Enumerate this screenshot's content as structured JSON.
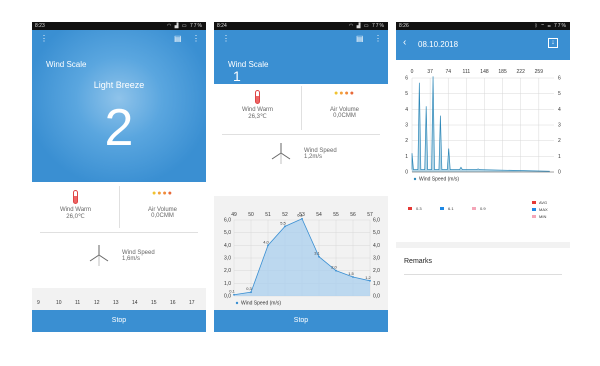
{
  "screen1": {
    "status": {
      "time": "8:23",
      "battery": "77%"
    },
    "title": "Wind Scale",
    "level_name": "Light Breeze",
    "level_number": "2",
    "wind_warm_label": "Wind Warm",
    "wind_warm_value": "26,0℃",
    "air_volume_label": "Air Volume",
    "air_volume_value": "0,0CMM",
    "wind_speed_label": "Wind Speed",
    "wind_speed_value": "1,6m/s",
    "x_ticks": [
      "9",
      "10",
      "11",
      "12",
      "13",
      "14",
      "15",
      "16",
      "17"
    ],
    "stop_label": "Stop"
  },
  "screen2": {
    "status": {
      "time": "8:24",
      "battery": "77%"
    },
    "title": "Wind Scale",
    "level_number": "1",
    "wind_warm_label": "Wind Warm",
    "wind_warm_value": "26,3℃",
    "air_volume_label": "Air Volume",
    "air_volume_value": "0,0CMM",
    "wind_speed_label": "Wind Speed",
    "wind_speed_value": "1,2m/s",
    "legend": "Wind Speed (m/s)",
    "stop_label": "Stop"
  },
  "screen3": {
    "status": {
      "time": "8:26",
      "battery": "77%"
    },
    "date": "08.10.2018",
    "legend": "Wind Speed (m/s)",
    "summary": [
      {
        "value": "0.3",
        "color": "#e53935"
      },
      {
        "value": "6.1",
        "color": "#1e88e5"
      },
      {
        "value": "0.9",
        "color": "#f4a6b8"
      }
    ],
    "stat_labels": [
      {
        "label": "AVG",
        "color": "#e53935"
      },
      {
        "label": "MAX",
        "color": "#1e88e5"
      },
      {
        "label": "MIN",
        "color": "#f4a6b8"
      }
    ],
    "remarks_label": "Remarks"
  },
  "chart_data": [
    {
      "type": "area",
      "x": [
        49,
        50,
        51,
        52,
        53,
        54,
        55,
        56,
        57
      ],
      "values": [
        0.1,
        0.3,
        4.0,
        5.5,
        6.1,
        3.1,
        2.0,
        1.5,
        1.2
      ],
      "point_labels": [
        "0,1",
        "0,3",
        "4,0",
        "5,5",
        "6,1",
        "3,1",
        "2,0",
        "1,5",
        "1,2"
      ],
      "y_ticks": [
        "0,0",
        "1,0",
        "2,0",
        "3,0",
        "4,0",
        "5,0",
        "6,0"
      ],
      "ylim": [
        0,
        6
      ],
      "legend": "Wind Speed (m/s)"
    },
    {
      "type": "line",
      "x_ticks": [
        "0",
        "37",
        "74",
        "111",
        "148",
        "185",
        "222",
        "259"
      ],
      "y_ticks": [
        "0",
        "1",
        "2",
        "3",
        "4",
        "5",
        "6"
      ],
      "ylim": [
        0,
        6
      ],
      "xlim": [
        0,
        290
      ],
      "peaks": [
        {
          "x": 0,
          "y": 1.2
        },
        {
          "x": 15,
          "y": 5.7
        },
        {
          "x": 29,
          "y": 4.2
        },
        {
          "x": 43,
          "y": 6.1
        },
        {
          "x": 58,
          "y": 3.6
        },
        {
          "x": 75,
          "y": 1.5
        },
        {
          "x": 100,
          "y": 0.3
        },
        {
          "x": 135,
          "y": 0.2
        }
      ],
      "legend": "Wind Speed (m/s)"
    }
  ]
}
